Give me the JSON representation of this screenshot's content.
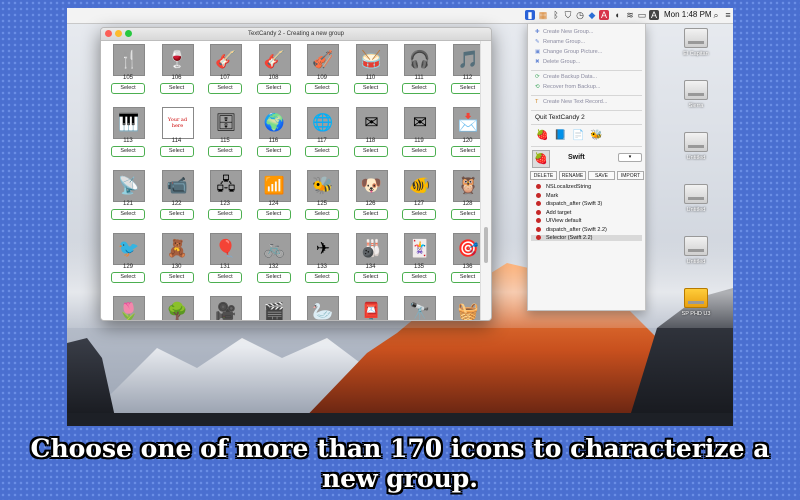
{
  "menubar": {
    "time": "Mon 1:48 PM",
    "status_icons": [
      "app-icon",
      "textcandy-icon",
      "bluetooth-icon",
      "shield-icon",
      "clock-icon",
      "dropbox-icon",
      "adobe-icon",
      "audio-icon",
      "wifi-icon",
      "battery-icon",
      "accessibility-icon",
      "search-icon",
      "list-icon"
    ]
  },
  "window": {
    "title": "TextCandy 2 - Creating a new group",
    "select_label": "Select",
    "icons": [
      {
        "num": "105",
        "glyph": "🍴"
      },
      {
        "num": "106",
        "glyph": "🍷"
      },
      {
        "num": "107",
        "glyph": "🎸"
      },
      {
        "num": "108",
        "glyph": "🎸"
      },
      {
        "num": "109",
        "glyph": "🎻"
      },
      {
        "num": "110",
        "glyph": "🥁"
      },
      {
        "num": "111",
        "glyph": "🎧"
      },
      {
        "num": "112",
        "glyph": "🎵"
      },
      {
        "num": "113",
        "glyph": "🎹"
      },
      {
        "num": "114",
        "glyph": "📄"
      },
      {
        "num": "115",
        "glyph": "🗄"
      },
      {
        "num": "116",
        "glyph": "🌍"
      },
      {
        "num": "117",
        "glyph": "🌐"
      },
      {
        "num": "118",
        "glyph": "✉"
      },
      {
        "num": "119",
        "glyph": "✉"
      },
      {
        "num": "120",
        "glyph": "📩"
      },
      {
        "num": "121",
        "glyph": "📡"
      },
      {
        "num": "122",
        "glyph": "📹"
      },
      {
        "num": "123",
        "glyph": "🖧"
      },
      {
        "num": "124",
        "glyph": "📶"
      },
      {
        "num": "125",
        "glyph": "🐝"
      },
      {
        "num": "126",
        "glyph": "🐶"
      },
      {
        "num": "127",
        "glyph": "🐠"
      },
      {
        "num": "128",
        "glyph": "🦉"
      },
      {
        "num": "129",
        "glyph": "🐦"
      },
      {
        "num": "130",
        "glyph": "🧸"
      },
      {
        "num": "131",
        "glyph": "🎈"
      },
      {
        "num": "132",
        "glyph": "🚲"
      },
      {
        "num": "133",
        "glyph": "✈"
      },
      {
        "num": "134",
        "glyph": "🎳"
      },
      {
        "num": "135",
        "glyph": "🃏"
      },
      {
        "num": "136",
        "glyph": "🎯"
      },
      {
        "num": "",
        "glyph": "🌷"
      },
      {
        "num": "",
        "glyph": "🌳"
      },
      {
        "num": "",
        "glyph": "🎥"
      },
      {
        "num": "",
        "glyph": "🎬"
      },
      {
        "num": "",
        "glyph": "🦢"
      },
      {
        "num": "",
        "glyph": "📮"
      },
      {
        "num": "",
        "glyph": "🔭"
      },
      {
        "num": "",
        "glyph": "🧺"
      }
    ],
    "tile_text_114": "Your ad here"
  },
  "menu": {
    "items_top": [
      "Create New Group...",
      "Rename Group...",
      "Change Group Picture...",
      "Delete Group..."
    ],
    "items_backup": [
      "Create Backup Data...",
      "Recover from Backup..."
    ],
    "item_text_record": "Create New Text Record...",
    "quit": "Quit TextCandy 2",
    "group_name": "Swift",
    "buttons": [
      "DELETE",
      "RENAME",
      "SAVE",
      "IMPORT"
    ],
    "snippets": [
      "NSLocalizedString",
      "Mark",
      "dispatch_after (Swift 3)",
      "Add target",
      "UIView default",
      "dispatch_after (Swift 2.2)",
      "Selector (Swift 2.2)"
    ],
    "selected_snippet_index": 6
  },
  "desktop": {
    "disks": [
      "El Capitan",
      "Sierra",
      "Untitled",
      "Untitled",
      "Untitled",
      "SP PHD U3"
    ]
  },
  "caption": "Choose one of more than 170 icons to characterize a new group.",
  "colors": {
    "frame_blue": "#4a6fd0",
    "select_border": "#4caf50",
    "snippet_dot": "#c62828"
  }
}
